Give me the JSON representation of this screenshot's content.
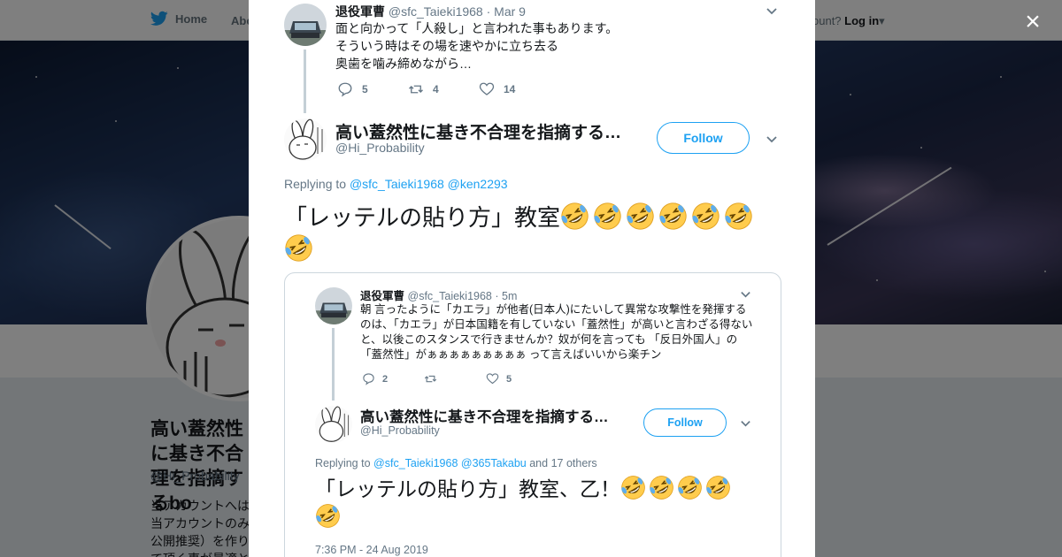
{
  "nav": {
    "home_label": "Home",
    "about_label": "Abo",
    "account_prompt": "ccount?",
    "login_label": "Log in"
  },
  "profile": {
    "name": "高い蓋然性に基き不合理を指摘するbo",
    "handle": "@Hi_Probability",
    "bio": "当アカウントへは当アカウントのみ公開推奨）を作りて頂く事が最適と"
  },
  "modal": {
    "close_label": "×",
    "parent_tweet": {
      "name": "退役軍曹",
      "handle": "@sfc_Taieki1968",
      "date": "· Mar 9",
      "text": "面と向かって「人殺し」と言われた事もあります。\nそういう時はその場を速やかに立ち去る\n奥歯を噛み締めながら…",
      "replies": "5",
      "retweets": "4",
      "likes": "14"
    },
    "main_tweet": {
      "name": "高い蓋然性に基き不合理を指摘する…",
      "handle": "@Hi_Probability",
      "follow_label": "Follow",
      "replying_prefix": "Replying to",
      "replying_users": "@sfc_Taieki1968 @ken2293",
      "text": "「レッテルの貼り方」教室",
      "emoji_count": 7,
      "emoji_icon": "rofl-emoji"
    },
    "embedded": {
      "parent": {
        "name": "退役軍曹",
        "handle": "@sfc_Taieki1968",
        "date": "· 5m",
        "text": "朝 言ったように「カエラ」が他者(日本人)にたいして異常な攻撃性を発揮するのは、「カエラ」が日本国籍を有していない「蓋然性」が高いと言わざる得ない と、以後このスタンスで行きませんか？奴が何を言っても 「反日外国人」の「蓋然性」がぁぁぁぁぁぁぁぁぁ って言えばいいから楽チン",
        "replies": "2",
        "retweets": "",
        "likes": "5"
      },
      "reply": {
        "name": "高い蓋然性に基き不合理を指摘する…",
        "handle": "@Hi_Probability",
        "follow_label": "Follow",
        "replying_prefix": "Replying to",
        "replying_users": "@sfc_Taieki1968 @365Takabu",
        "replying_suffix": "and 17 others",
        "text": "「レッテルの貼り方」教室、乙！",
        "emoji_count": 5,
        "timestamp": "7:36 PM - 24 Aug 2019"
      }
    }
  },
  "colors": {
    "accent": "#1da1f2",
    "text": "#14171a",
    "muted": "#657786",
    "emoji_face": "#ffcc4d"
  }
}
